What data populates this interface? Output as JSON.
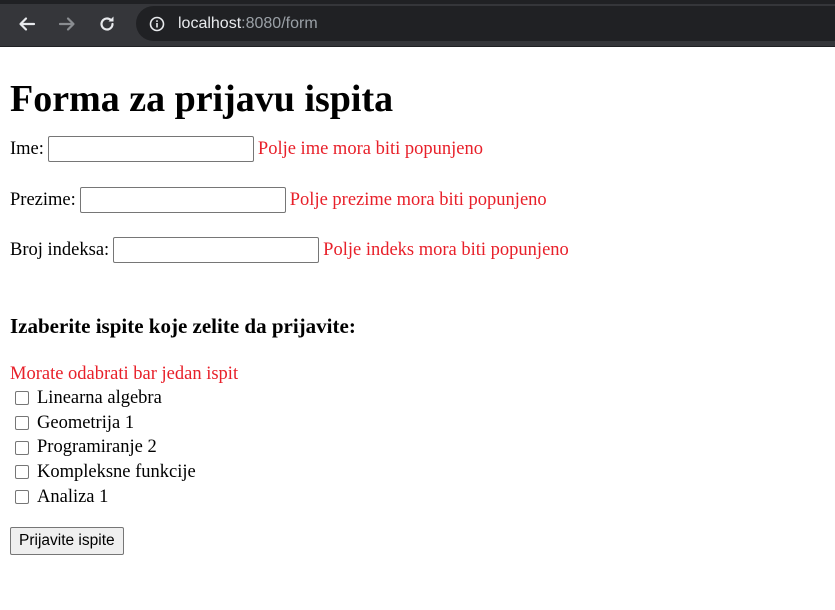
{
  "browser": {
    "url_host": "localhost",
    "url_rest": ":8080/form",
    "back_icon": "arrow-left-icon",
    "forward_icon": "arrow-right-icon",
    "reload_icon": "reload-icon",
    "info_icon": "info-icon"
  },
  "form": {
    "title": "Forma za prijavu ispita",
    "fields": [
      {
        "label": "Ime:",
        "value": "",
        "error": "Polje ime mora biti popunjeno"
      },
      {
        "label": "Prezime:",
        "value": "",
        "error": "Polje prezime mora biti popunjeno"
      },
      {
        "label": "Broj indeksa:",
        "value": "",
        "error": "Polje indeks mora biti popunjeno"
      }
    ],
    "exams_heading": "Izaberite ispite koje zelite da prijavite:",
    "exams_error": "Morate odabrati bar jedan ispit",
    "exams": [
      {
        "label": "Linearna algebra",
        "checked": false
      },
      {
        "label": "Geometrija 1",
        "checked": false
      },
      {
        "label": "Programiranje 2",
        "checked": false
      },
      {
        "label": "Kompleksne funkcije",
        "checked": false
      },
      {
        "label": "Analiza 1",
        "checked": false
      }
    ],
    "submit_label": "Prijavite ispite"
  },
  "colors": {
    "error": "#e8202a",
    "chrome_bg": "#35363a",
    "omnibox_bg": "#202124"
  }
}
